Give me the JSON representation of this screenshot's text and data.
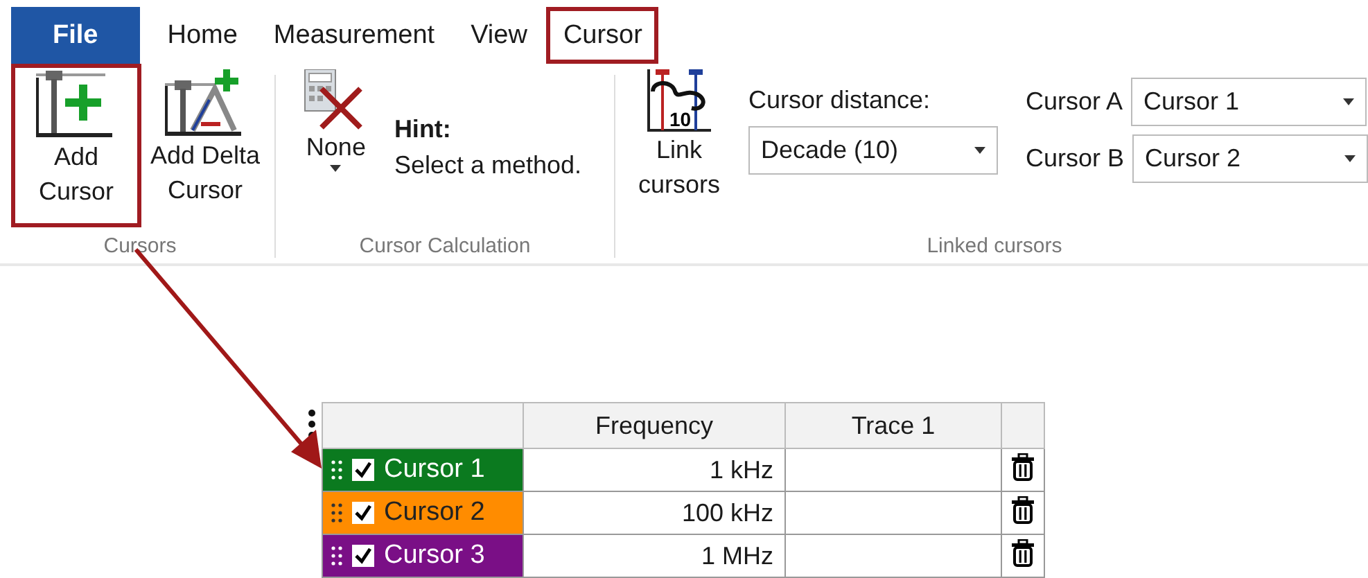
{
  "tabs": [
    {
      "label": "File",
      "kind": "file",
      "highlighted": false
    },
    {
      "label": "Home",
      "kind": "tab",
      "highlighted": false
    },
    {
      "label": "Measurement",
      "kind": "tab",
      "highlighted": false
    },
    {
      "label": "View",
      "kind": "tab",
      "highlighted": false
    },
    {
      "label": "Cursor",
      "kind": "tab",
      "highlighted": true
    }
  ],
  "ribbon": {
    "cursors_group": {
      "label": "Cursors",
      "buttons": [
        {
          "label_lines": [
            "Add",
            "Cursor"
          ],
          "kind": "add",
          "highlighted": true
        },
        {
          "label_lines": [
            "Add Delta",
            "Cursor"
          ],
          "kind": "delta",
          "highlighted": false
        }
      ]
    },
    "calculation_group": {
      "label": "Cursor Calculation",
      "method_button": "None",
      "hint_title": "Hint:",
      "hint_text": "Select a method."
    },
    "linked_group": {
      "label": "Linked cursors",
      "link_icon_digits": "10",
      "link_button_lines": [
        "Link",
        "cursors"
      ],
      "distance_label": "Cursor distance:",
      "distance_value": "Decade (10)",
      "cursor_a_label": "Cursor A",
      "cursor_a_value": "Cursor 1",
      "cursor_b_label": "Cursor B",
      "cursor_b_value": "Cursor 2"
    }
  },
  "cursor_table": {
    "columns": [
      "Frequency",
      "Trace 1"
    ],
    "rows": [
      {
        "name": "Cursor 1",
        "color": "#0b7a1f",
        "checked": true,
        "frequency": "1 kHz"
      },
      {
        "name": "Cursor 2",
        "color": "#ff8c00",
        "checked": true,
        "frequency": "100 kHz"
      },
      {
        "name": "Cursor 3",
        "color": "#7a0f86",
        "checked": true,
        "frequency": "1 MHz"
      }
    ]
  }
}
